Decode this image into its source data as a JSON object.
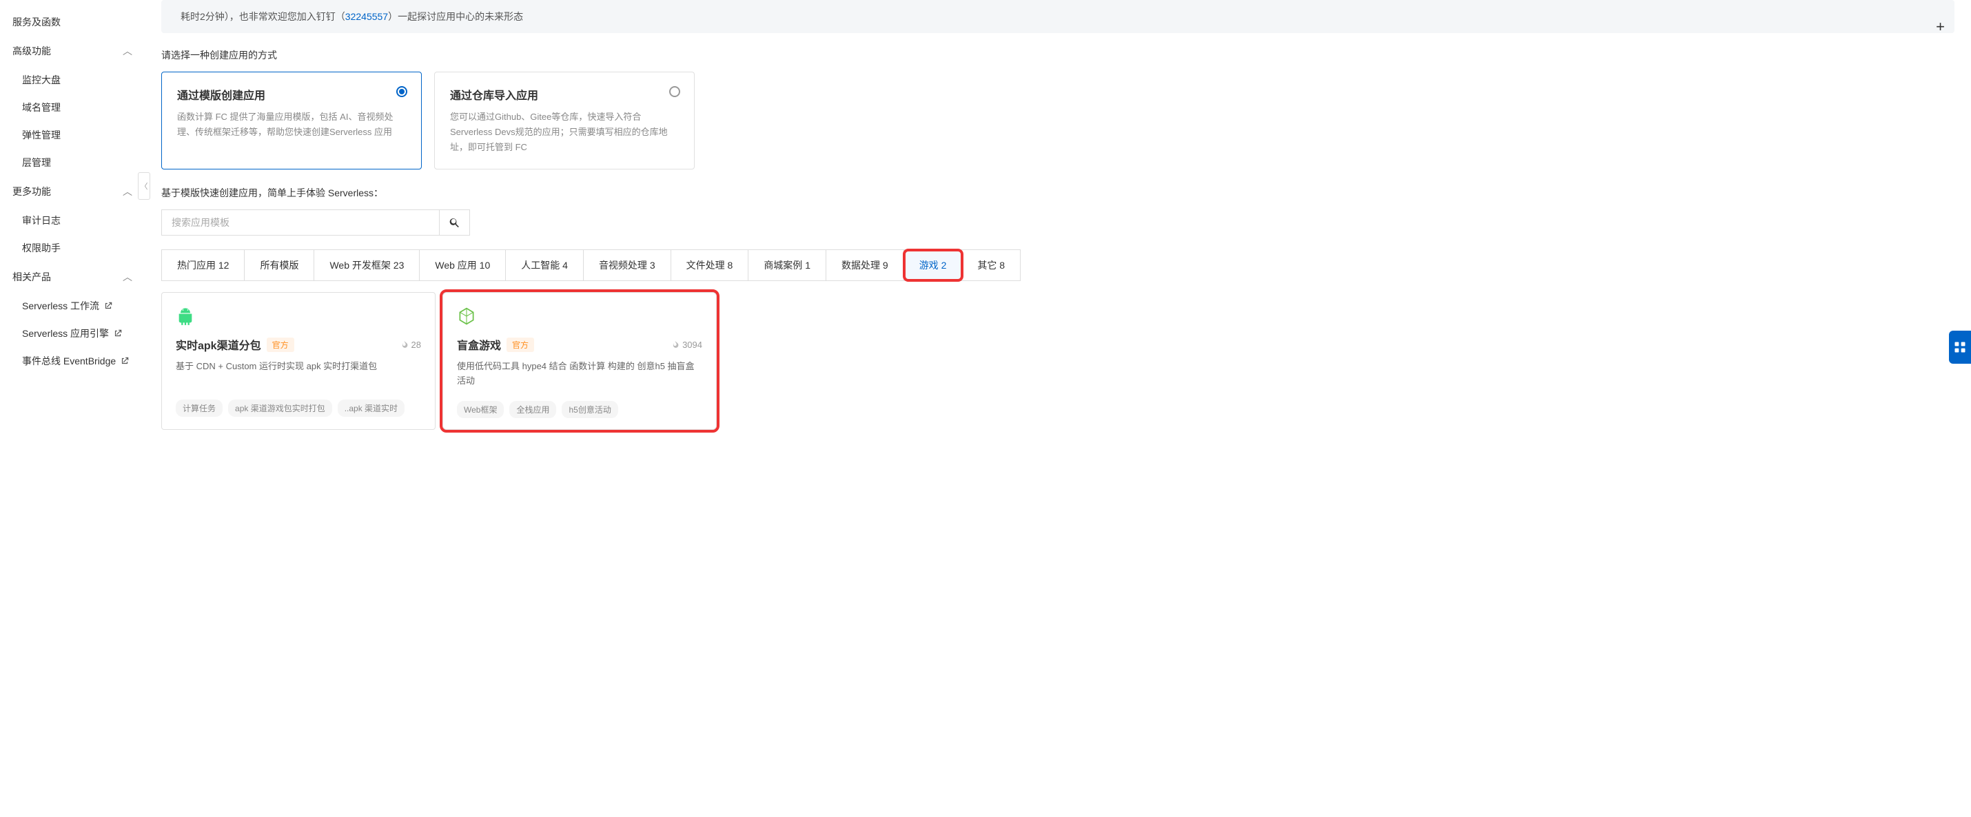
{
  "sidebar": {
    "topItems": [
      {
        "label": "服务及函数"
      }
    ],
    "groups": [
      {
        "title": "高级功能",
        "items": [
          {
            "label": "监控大盘"
          },
          {
            "label": "域名管理"
          },
          {
            "label": "弹性管理"
          },
          {
            "label": "层管理"
          }
        ]
      },
      {
        "title": "更多功能",
        "items": [
          {
            "label": "审计日志"
          },
          {
            "label": "权限助手"
          }
        ]
      },
      {
        "title": "相关产品",
        "items": [
          {
            "label": "Serverless 工作流",
            "external": true
          },
          {
            "label": "Serverless 应用引擎",
            "external": true
          },
          {
            "label": "事件总线 EventBridge",
            "external": true
          }
        ]
      }
    ]
  },
  "banner": {
    "textPrefix": "耗时2分钟），也非常欢迎您加入钉钉（",
    "link": "32245557",
    "textSuffix": "）一起探讨应用中心的未来形态"
  },
  "subtitle": "请选择一种创建应用的方式",
  "options": [
    {
      "title": "通过模版创建应用",
      "desc": "函数计算 FC 提供了海量应用模版，包括 AI、音视频处理、传统框架迁移等，帮助您快速创建Serverless 应用",
      "selected": true
    },
    {
      "title": "通过仓库导入应用",
      "desc": "您可以通过Github、Gitee等仓库，快速导入符合 Serverless Devs规范的应用；只需要填写相应的仓库地址，即可托管到 FC",
      "selected": false
    }
  ],
  "templateNote": "基于模版快速创建应用，简单上手体验 Serverless：",
  "search": {
    "placeholder": "搜索应用模板"
  },
  "tabs": [
    {
      "label": "热门应用 12"
    },
    {
      "label": "所有模版"
    },
    {
      "label": "Web 开发框架 23"
    },
    {
      "label": "Web 应用 10"
    },
    {
      "label": "人工智能 4"
    },
    {
      "label": "音视频处理 3"
    },
    {
      "label": "文件处理 8"
    },
    {
      "label": "商城案例 1"
    },
    {
      "label": "数据处理 9"
    },
    {
      "label": "游戏 2",
      "active": true,
      "highlight": true
    },
    {
      "label": "其它 8"
    }
  ],
  "cards": [
    {
      "icon": "android",
      "title": "实时apk渠道分包",
      "badge": "官方",
      "hot": "28",
      "desc": "基于 CDN + Custom 运行时实现 apk 实时打渠道包",
      "tags": [
        "计算任务",
        "apk 渠道游戏包实时打包",
        "..apk 渠道实时"
      ]
    },
    {
      "icon": "nodejs",
      "title": "盲盒游戏",
      "badge": "官方",
      "hot": "3094",
      "desc": "使用低代码工具 hype4 结合 函数计算 构建的 创意h5 抽盲盒活动",
      "tags": [
        "Web框架",
        "全栈应用",
        "h5创意活动"
      ],
      "highlight": true
    }
  ]
}
